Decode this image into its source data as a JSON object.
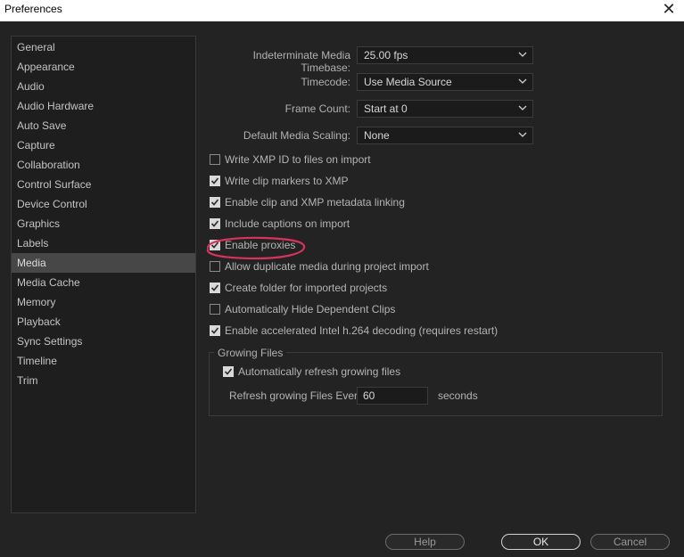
{
  "window": {
    "title": "Preferences"
  },
  "sidebar": {
    "items": [
      "General",
      "Appearance",
      "Audio",
      "Audio Hardware",
      "Auto Save",
      "Capture",
      "Collaboration",
      "Control Surface",
      "Device Control",
      "Graphics",
      "Labels",
      "Media",
      "Media Cache",
      "Memory",
      "Playback",
      "Sync Settings",
      "Timeline",
      "Trim"
    ],
    "selected": "Media"
  },
  "settings": {
    "timebase": {
      "label": "Indeterminate Media Timebase:",
      "value": "25.00 fps"
    },
    "timecode": {
      "label": "Timecode:",
      "value": "Use Media Source"
    },
    "frame_count": {
      "label": "Frame Count:",
      "value": "Start at 0"
    },
    "scaling": {
      "label": "Default Media Scaling:",
      "value": "None"
    }
  },
  "checkboxes": [
    {
      "label": "Write XMP ID to files on import",
      "checked": false
    },
    {
      "label": "Write clip markers to XMP",
      "checked": true
    },
    {
      "label": "Enable clip and XMP metadata linking",
      "checked": true
    },
    {
      "label": "Include captions on import",
      "checked": true
    },
    {
      "label": "Enable proxies",
      "checked": true
    },
    {
      "label": "Allow duplicate media during project import",
      "checked": false
    },
    {
      "label": "Create folder for imported projects",
      "checked": true
    },
    {
      "label": "Automatically Hide Dependent Clips",
      "checked": false
    },
    {
      "label": "Enable accelerated Intel h.264 decoding (requires restart)",
      "checked": true
    }
  ],
  "growing_files": {
    "title": "Growing Files",
    "auto_refresh": {
      "label": "Automatically refresh growing files",
      "checked": true
    },
    "refresh_label": "Refresh growing Files Every",
    "refresh_value": "60",
    "refresh_unit": "seconds"
  },
  "buttons": {
    "help": "Help",
    "ok": "OK",
    "cancel": "Cancel"
  },
  "icons": {
    "close": "close-icon",
    "chevron": "chevron-down-icon",
    "check": "check-icon"
  },
  "colors": {
    "background": "#232323",
    "selected": "#474747",
    "annotation": "#d8325f"
  }
}
